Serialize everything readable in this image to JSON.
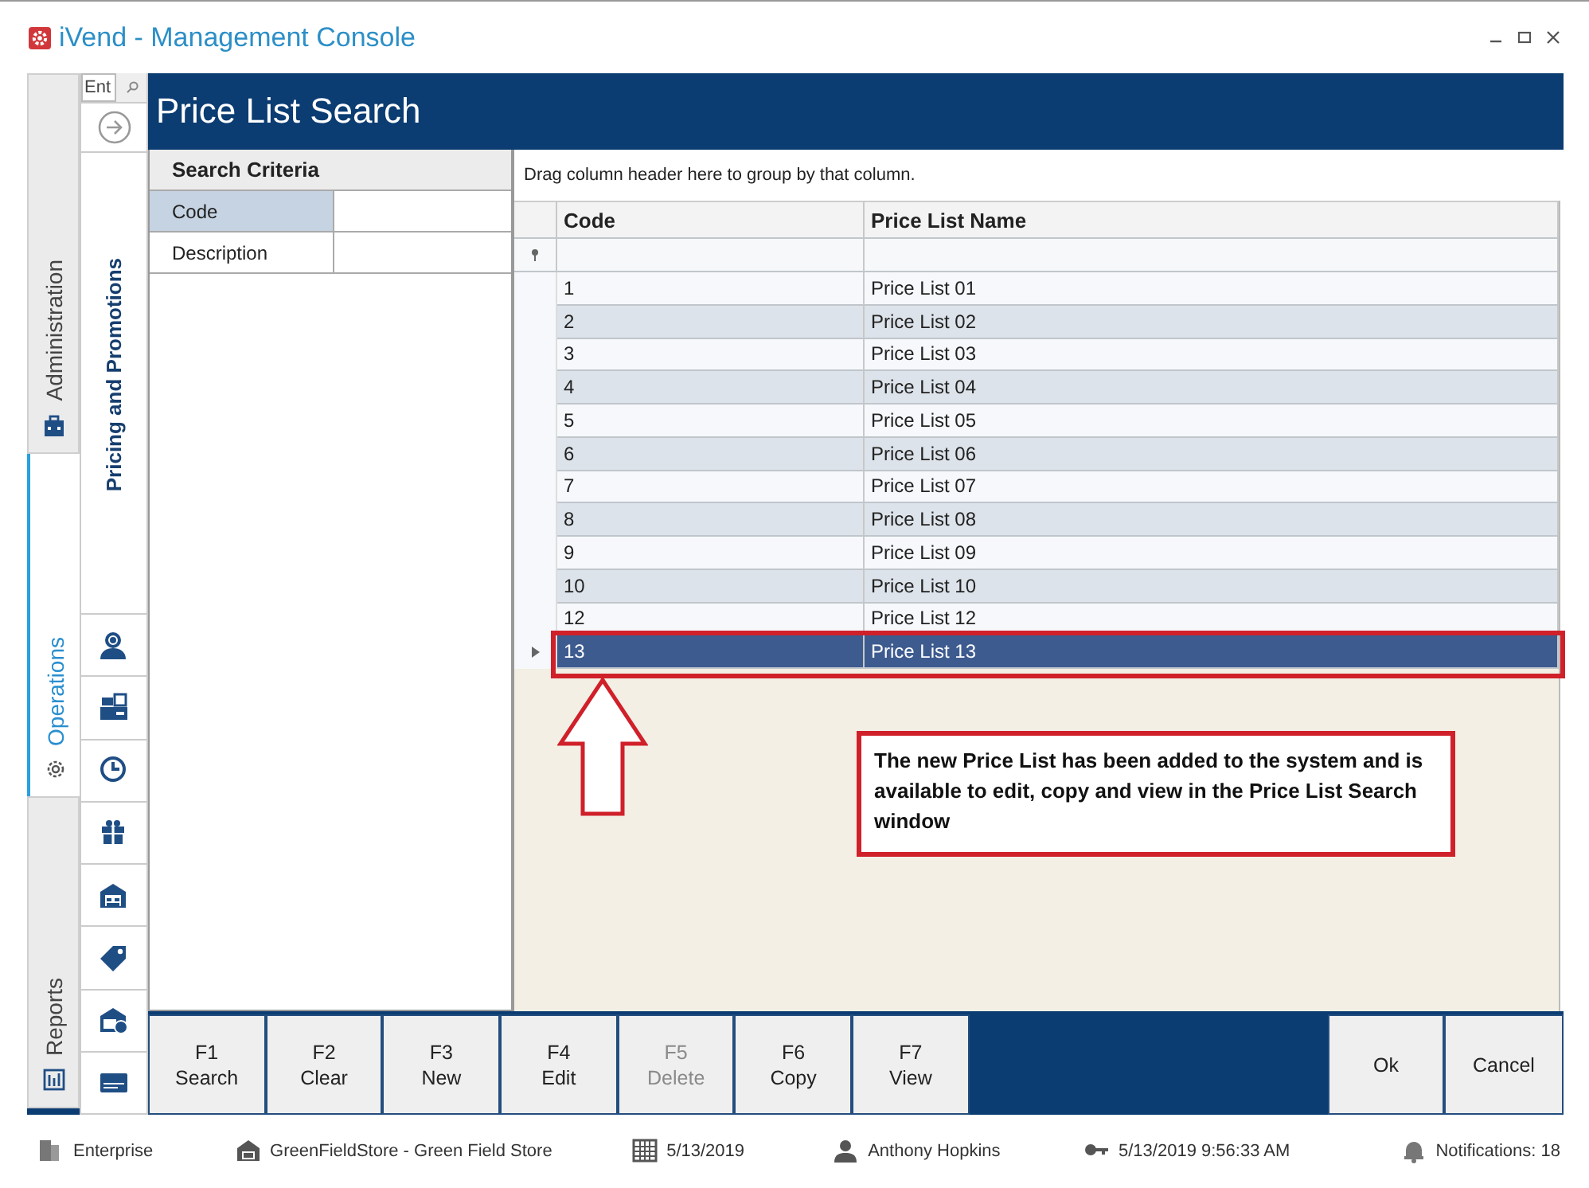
{
  "window": {
    "title": "iVend - Management Console"
  },
  "nav_tabs": [
    {
      "label": "Administration",
      "selected": false
    },
    {
      "label": "Operations",
      "selected": true
    },
    {
      "label": "Reports",
      "selected": false
    }
  ],
  "module_search": {
    "placeholder": "Ent"
  },
  "module": {
    "label": "Pricing and Promotions"
  },
  "page": {
    "title": "Price List Search"
  },
  "search_criteria": {
    "heading": "Search Criteria",
    "fields": [
      {
        "label": "Code",
        "selected": true
      },
      {
        "label": "Description",
        "selected": false
      }
    ]
  },
  "grid": {
    "group_hint": "Drag column header here to group by that column.",
    "columns": [
      "Code",
      "Price List Name"
    ],
    "rows": [
      {
        "code": "1",
        "name": "Price List 01",
        "selected": false
      },
      {
        "code": "2",
        "name": "Price List 02",
        "selected": false
      },
      {
        "code": "3",
        "name": "Price List 03",
        "selected": false
      },
      {
        "code": "4",
        "name": "Price List 04",
        "selected": false
      },
      {
        "code": "5",
        "name": "Price List 05",
        "selected": false
      },
      {
        "code": "6",
        "name": "Price List 06",
        "selected": false
      },
      {
        "code": "7",
        "name": "Price List 07",
        "selected": false
      },
      {
        "code": "8",
        "name": "Price List 08",
        "selected": false
      },
      {
        "code": "9",
        "name": "Price List 09",
        "selected": false
      },
      {
        "code": "10",
        "name": "Price List 10",
        "selected": false
      },
      {
        "code": "12",
        "name": "Price List 12",
        "selected": false
      },
      {
        "code": "13",
        "name": "Price List 13",
        "selected": true
      }
    ]
  },
  "annotation": {
    "text": "The new Price List has been added to the system and is available to edit, copy and view in the Price List Search window"
  },
  "function_keys": [
    {
      "key": "F1",
      "label": "Search",
      "disabled": false
    },
    {
      "key": "F2",
      "label": "Clear",
      "disabled": false
    },
    {
      "key": "F3",
      "label": "New",
      "disabled": false
    },
    {
      "key": "F4",
      "label": "Edit",
      "disabled": false
    },
    {
      "key": "F5",
      "label": "Delete",
      "disabled": true
    },
    {
      "key": "F6",
      "label": "Copy",
      "disabled": false
    },
    {
      "key": "F7",
      "label": "View",
      "disabled": false
    }
  ],
  "dialog_buttons": [
    "Ok",
    "Cancel"
  ],
  "status_bar": [
    {
      "kind": "enterprise",
      "text": "Enterprise"
    },
    {
      "kind": "store",
      "text": "GreenFieldStore - Green Field Store"
    },
    {
      "kind": "date",
      "text": "5/13/2019"
    },
    {
      "kind": "user",
      "text": "Anthony Hopkins"
    },
    {
      "kind": "login",
      "text": "5/13/2019 9:56:33 AM"
    },
    {
      "kind": "notifications",
      "text": "Notifications: 18"
    }
  ]
}
